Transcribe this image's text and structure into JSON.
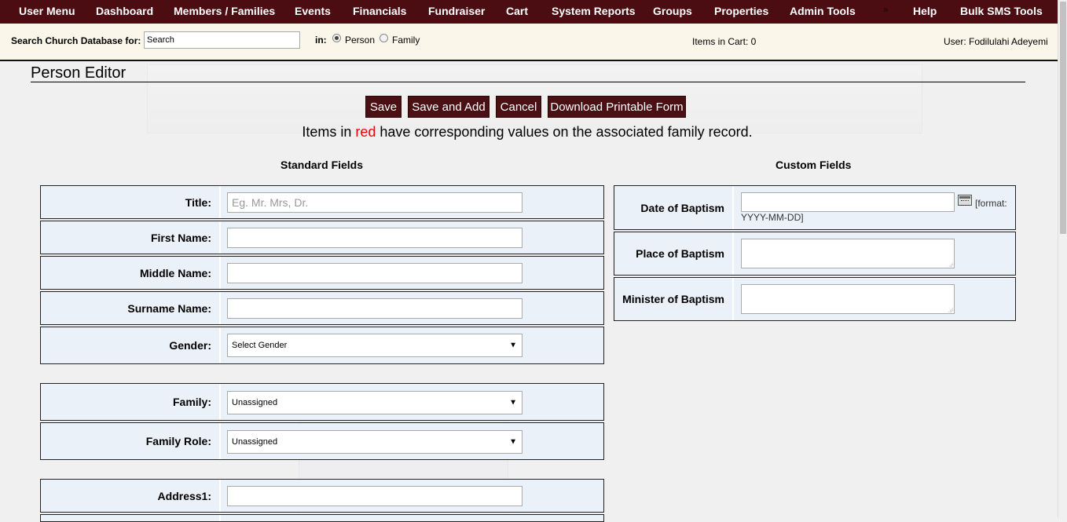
{
  "nav": {
    "items": [
      "User Menu",
      "Dashboard",
      "Members / Families",
      "Events",
      "Financials",
      "Fundraiser",
      "Cart",
      "System Reports",
      "Groups",
      "Properties",
      "Admin Tools",
      "Help",
      "Bulk SMS Tools"
    ],
    "separator": "»"
  },
  "search": {
    "label": "Search Church Database for:",
    "value": "Search",
    "in_label": "in:",
    "options": [
      "Person",
      "Family"
    ],
    "selected": "Person",
    "cart": "Items in Cart: 0",
    "user": "User: Fodilulahi Adeyemi"
  },
  "page": {
    "title": "Person Editor",
    "buttons": [
      "Save",
      "Save and Add",
      "Cancel",
      "Download Printable Form"
    ],
    "note_before": "Items in ",
    "note_red": "red",
    "note_after": " have corresponding values on the associated family record.",
    "standard_heading": "Standard Fields",
    "custom_heading": "Custom Fields"
  },
  "standard": {
    "title_label": "Title:",
    "title_placeholder": "Eg. Mr. Mrs, Dr.",
    "first_label": "First Name:",
    "middle_label": "Middle Name:",
    "surname_label": "Surname Name:",
    "gender_label": "Gender:",
    "gender_value": "Select Gender",
    "family_label": "Family:",
    "family_value": "Unassigned",
    "role_label": "Family Role:",
    "role_value": "Unassigned",
    "address1_label": "Address1:"
  },
  "custom": {
    "baptism_date_label": "Date of Baptism",
    "baptism_date_format": "[format:",
    "baptism_date_format2": "YYYY-MM-DD]",
    "baptism_place_label": "Place of Baptism",
    "baptism_minister_label": "Minister of Baptism"
  }
}
